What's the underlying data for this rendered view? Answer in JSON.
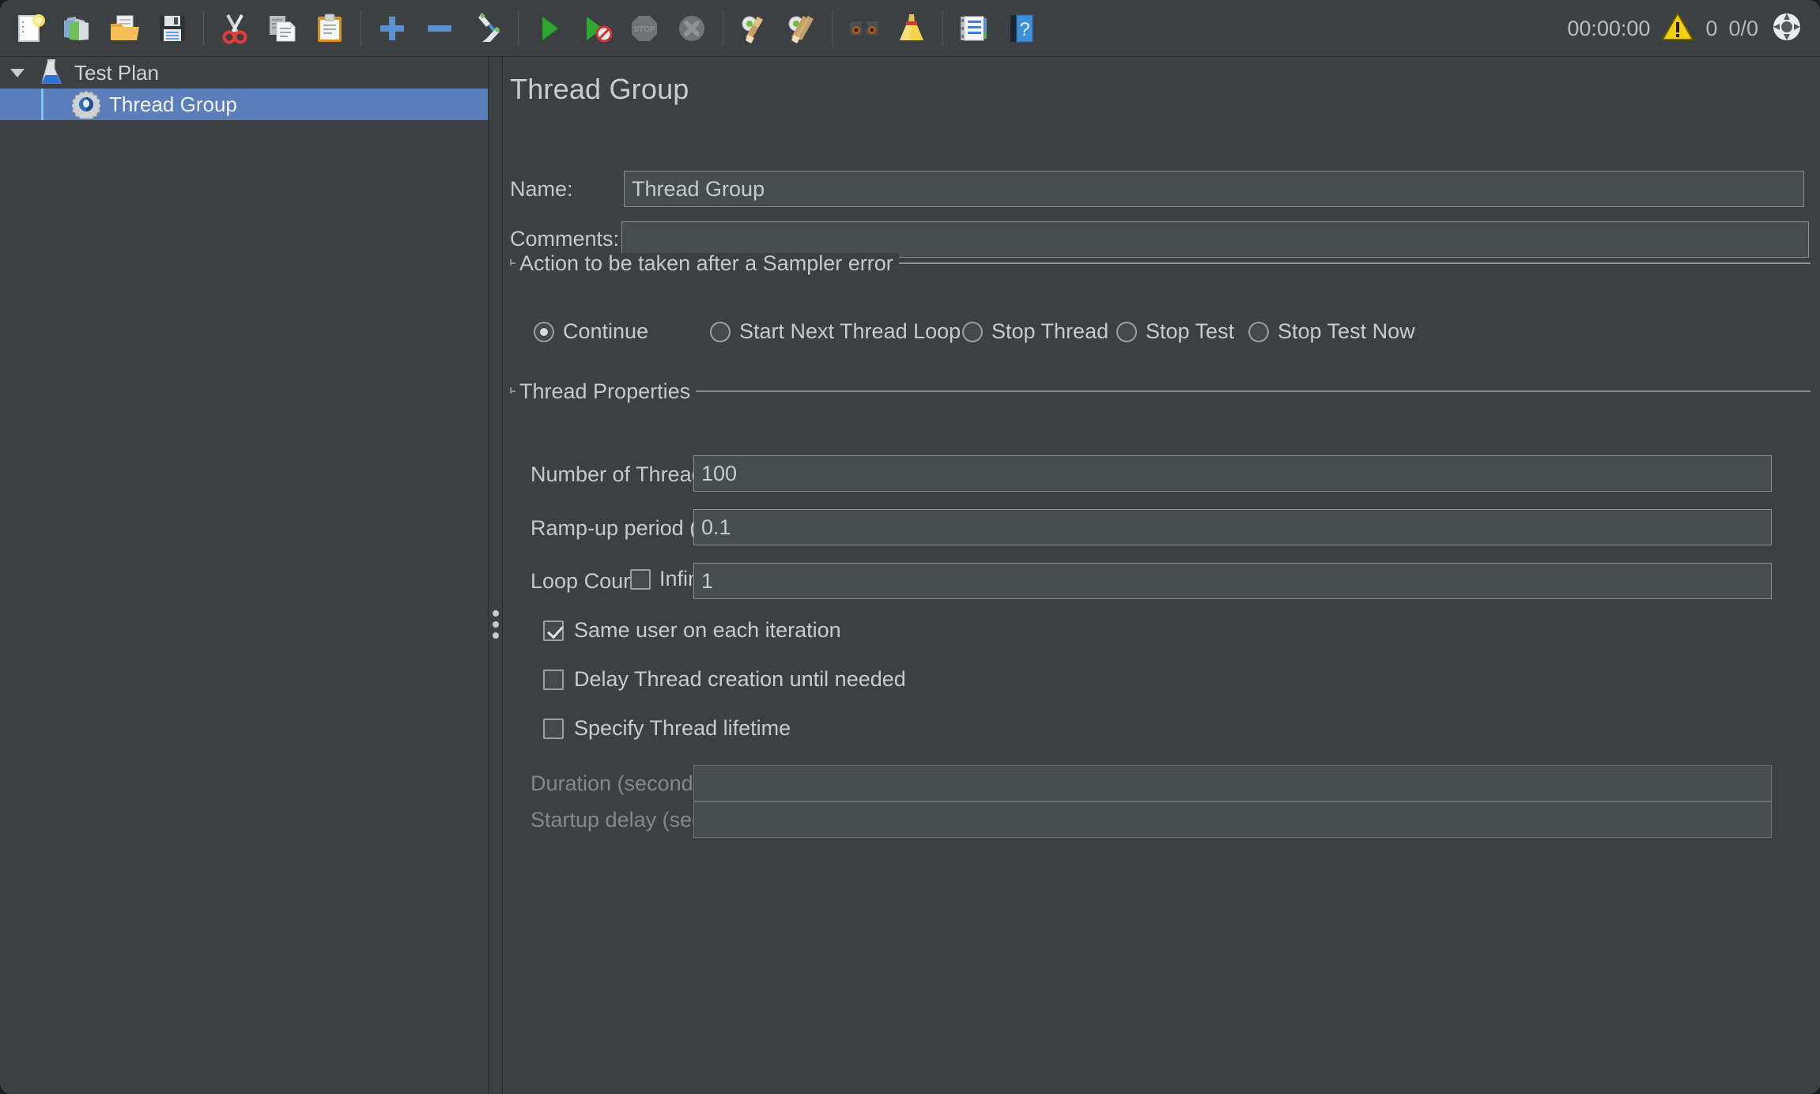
{
  "toolbar": {
    "buttons": [
      {
        "name": "new-button",
        "label": "New"
      },
      {
        "name": "templates-button",
        "label": "Templates"
      },
      {
        "name": "open-button",
        "label": "Open"
      },
      {
        "name": "save-button",
        "label": "Save Test Plan"
      },
      {
        "name": "cut-button",
        "label": "Cut"
      },
      {
        "name": "copy-button",
        "label": "Copy"
      },
      {
        "name": "paste-button",
        "label": "Paste"
      },
      {
        "name": "expand-all-button",
        "label": "Expand All"
      },
      {
        "name": "collapse-all-button",
        "label": "Collapse All"
      },
      {
        "name": "toggle-button",
        "label": "Toggle"
      },
      {
        "name": "start-button",
        "label": "Start"
      },
      {
        "name": "start-no-pauses-button",
        "label": "Start no pauses"
      },
      {
        "name": "stop-button",
        "label": "Stop"
      },
      {
        "name": "shutdown-button",
        "label": "Shutdown"
      },
      {
        "name": "clear-button",
        "label": "Clear"
      },
      {
        "name": "clear-all-button",
        "label": "Clear All"
      },
      {
        "name": "search-button",
        "label": "Search"
      },
      {
        "name": "reset-search-button",
        "label": "Reset Search"
      },
      {
        "name": "function-helper-button",
        "label": "Function Helper Dialog"
      },
      {
        "name": "help-button",
        "label": "Help"
      }
    ]
  },
  "status": {
    "elapsed_time": "00:00:00",
    "warning_count": "0",
    "threads_running": "0/0"
  },
  "tree": {
    "items": [
      {
        "label": "Test Plan",
        "icon": "test-plan-flask-icon",
        "selected": false,
        "expanded": true
      },
      {
        "label": "Thread Group",
        "icon": "thread-group-gear-icon",
        "selected": true,
        "expanded": false
      }
    ]
  },
  "main": {
    "title": "Thread Group",
    "name_label": "Name:",
    "name_value": "Thread Group",
    "comments_label": "Comments:",
    "comments_value": "",
    "sampler_error": {
      "legend": "Action to be taken after a Sampler error",
      "options": [
        {
          "label": "Continue",
          "checked": true
        },
        {
          "label": "Start Next Thread Loop",
          "checked": false
        },
        {
          "label": "Stop Thread",
          "checked": false
        },
        {
          "label": "Stop Test",
          "checked": false
        },
        {
          "label": "Stop Test Now",
          "checked": false
        }
      ]
    },
    "thread_properties": {
      "legend": "Thread Properties",
      "num_threads_label": "Number of Threads (users):",
      "num_threads_value": "100",
      "ramp_up_label": "Ramp-up period (seconds):",
      "ramp_up_value": "0.1",
      "loop_count_label": "Loop Count:",
      "loop_infinite_label": "Infinite",
      "loop_infinite_checked": false,
      "loop_count_value": "1",
      "same_user_label": "Same user on each iteration",
      "same_user_checked": true,
      "delay_thread_label": "Delay Thread creation until needed",
      "delay_thread_checked": false,
      "specify_lifetime_label": "Specify Thread lifetime",
      "specify_lifetime_checked": false,
      "duration_label": "Duration (seconds):",
      "duration_value": "",
      "startup_delay_label": "Startup delay (seconds):",
      "startup_delay_value": ""
    }
  },
  "colors": {
    "background": "#3c4043",
    "field_bg": "#474c4f",
    "selection": "#5a7dbb",
    "text": "#c8cbce",
    "disabled_text": "#84888b",
    "border": "#8a8e91"
  }
}
